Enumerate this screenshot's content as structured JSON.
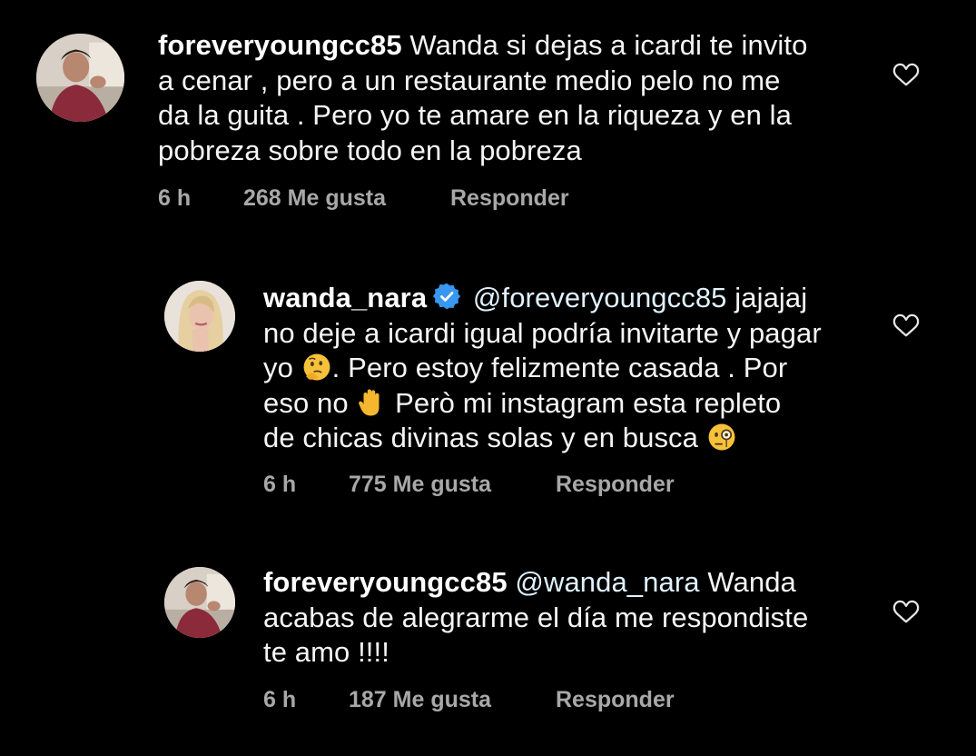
{
  "comments": [
    {
      "username": "foreveryoungcc85",
      "verified": false,
      "mention": "",
      "text_lines": [
        "Wanda si dejas a icardi te invito",
        "a cenar , pero a un restaurante medio pelo no me",
        "da la guita . Pero yo te amare en la riqueza y en la",
        "pobreza sobre todo en la pobreza"
      ],
      "time": "6 h",
      "likes": "268 Me gusta",
      "reply": "Responder"
    },
    {
      "username": "wanda_nara",
      "verified": true,
      "mention": "@foreveryoungcc85",
      "text_lines": [
        "jajajaj",
        "no deje a icardi igual podría invitarte y pagar",
        "yo",
        ". Pero estoy felizmente casada .  Por",
        "eso no",
        "Però mi instagram esta repleto",
        "de chicas divinas solas y en busca"
      ],
      "emojis": [
        "thinking-face-emoji",
        "raised-hand-emoji",
        "face-with-monocle-emoji"
      ],
      "time": "6 h",
      "likes": "775 Me gusta",
      "reply": "Responder"
    },
    {
      "username": "foreveryoungcc85",
      "verified": false,
      "mention": "@wanda_nara",
      "text_lines": [
        "Wanda",
        "acabas de alegrarme el día me respondiste",
        "te amo !!!!"
      ],
      "time": "6 h",
      "likes": "187 Me gusta",
      "reply": "Responder"
    }
  ],
  "colors": {
    "background": "#000000",
    "text": "#f5f5f5",
    "meta": "#a8a8a8",
    "verified": "#3897f0"
  },
  "icons": {
    "like": "heart-outline-icon",
    "verified": "verified-badge-icon"
  }
}
